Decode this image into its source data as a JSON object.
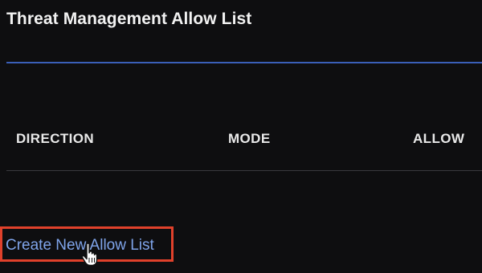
{
  "header": {
    "title": "Threat Management Allow List"
  },
  "table": {
    "columns": [
      "DIRECTION",
      "MODE",
      "ALLOW"
    ]
  },
  "actions": {
    "create_label": "Create New Allow List"
  },
  "colors": {
    "background": "#0e0e10",
    "accent_rule": "#3a5fb8",
    "link": "#7fa4ea",
    "highlight_box": "#e0412b"
  },
  "icons": {
    "cursor": "hand-pointer-icon"
  }
}
